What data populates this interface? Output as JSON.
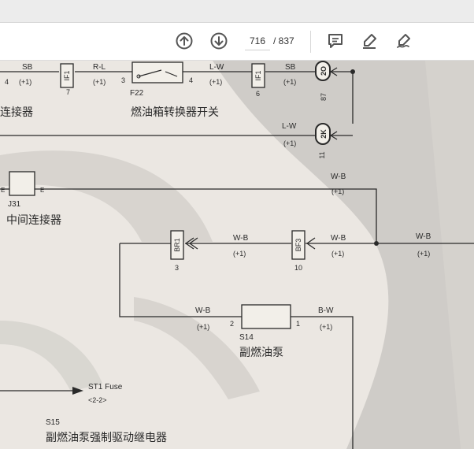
{
  "toolbar": {
    "page_current": "716",
    "page_total": "/ 837",
    "icons": [
      "arrow-up-circle-icon",
      "arrow-down-circle-icon",
      "comment-icon",
      "highlighter-icon",
      "sign-icon"
    ]
  },
  "diagram": {
    "sb1": "SB",
    "sb1_val": "(+1)",
    "sb1_num": "4",
    "if1a": "IF1",
    "if1a_num": "7",
    "rl": "R-L",
    "rl_val": "(+1)",
    "rl_num": "3",
    "f22_id": "F22",
    "f22_name": "燃油箱转换器开关",
    "f22_num": "4",
    "lw1": "L-W",
    "lw1_val": "(+1)",
    "if1b": "IF1",
    "if1b_num": "6",
    "sb2": "SB",
    "sb2_val": "(+1)",
    "conn_2o": "2O",
    "conn_2o_num": "87",
    "conn_left_text": "连接器",
    "lw2": "L-W",
    "lw2_val": "(+1)",
    "conn_2k": "2K",
    "conn_2k_num": "11",
    "j31_id": "J31",
    "j31_name": "中间连接器",
    "j31_e1": "E",
    "j31_e2": "E",
    "wb1": "W-B",
    "wb1_val": "(+1)",
    "br1": "BR1",
    "br1_num": "3",
    "wb2": "W-B",
    "wb2_val": "(+1)",
    "bf3": "BF3",
    "bf3_num": "10",
    "wb3": "W-B",
    "wb3_val": "(+1)",
    "wb4": "W-B",
    "wb4_val": "(+1)",
    "wb5": "W-B",
    "wb5_val": "(+1)",
    "s14_id": "S14",
    "s14_name": "副燃油泵",
    "s14_pin2": "2",
    "s14_pin1": "1",
    "bw": "B-W",
    "bw_val": "(+1)",
    "st1_fuse": "ST1 Fuse",
    "st1_ref": "<2-2>",
    "s15_id": "S15",
    "s15_name": "副燃油泵强制驱动继电器"
  },
  "colors": {
    "toolbar_bg": "#ffffff",
    "icon": "#555555",
    "doc_bg": "#ebe7e2",
    "wire": "#2a2a2a"
  }
}
